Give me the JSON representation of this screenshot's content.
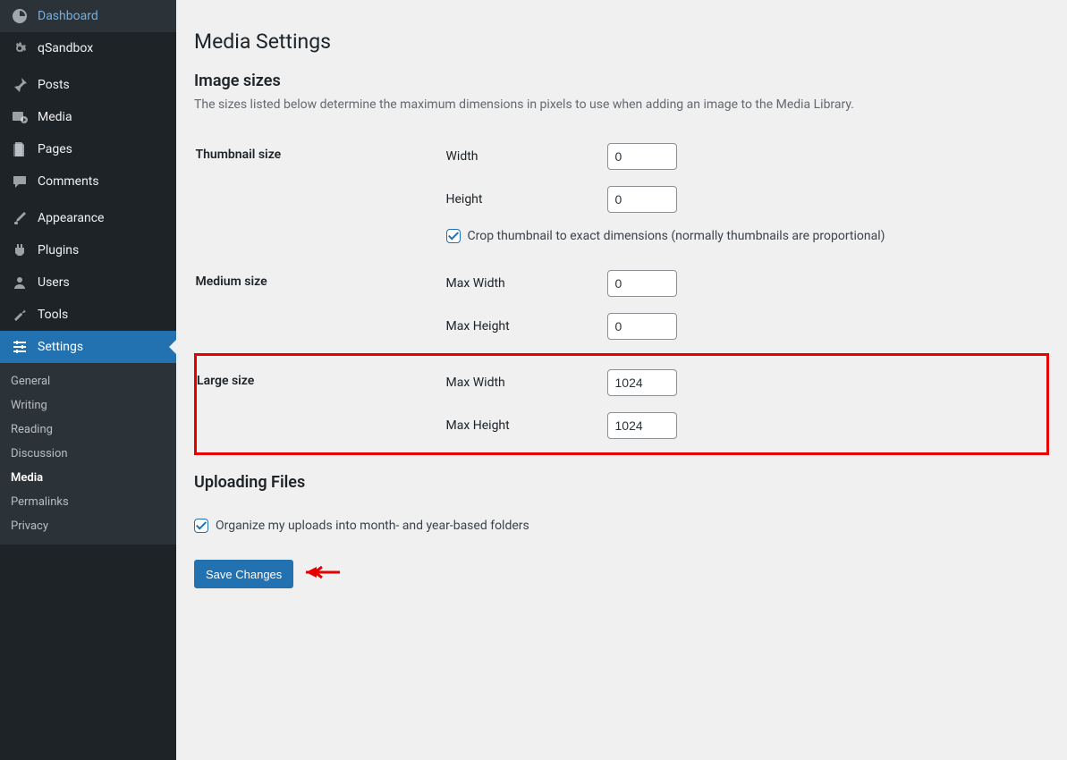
{
  "sidebar": {
    "items": [
      {
        "icon": "dashboard",
        "label": "Dashboard"
      },
      {
        "icon": "gear",
        "label": "qSandbox"
      },
      {
        "icon": "pin",
        "label": "Posts"
      },
      {
        "icon": "media",
        "label": "Media"
      },
      {
        "icon": "page",
        "label": "Pages"
      },
      {
        "icon": "comment",
        "label": "Comments"
      },
      {
        "icon": "brush",
        "label": "Appearance"
      },
      {
        "icon": "plugin",
        "label": "Plugins"
      },
      {
        "icon": "user",
        "label": "Users"
      },
      {
        "icon": "wrench",
        "label": "Tools"
      },
      {
        "icon": "settings",
        "label": "Settings"
      }
    ],
    "submenu": [
      {
        "label": "General"
      },
      {
        "label": "Writing"
      },
      {
        "label": "Reading"
      },
      {
        "label": "Discussion"
      },
      {
        "label": "Media"
      },
      {
        "label": "Permalinks"
      },
      {
        "label": "Privacy"
      }
    ]
  },
  "page": {
    "title": "Media Settings",
    "image_sizes_heading": "Image sizes",
    "image_sizes_description": "The sizes listed below determine the maximum dimensions in pixels to use when adding an image to the Media Library.",
    "thumbnail": {
      "label": "Thumbnail size",
      "width_label": "Width",
      "width_value": "0",
      "height_label": "Height",
      "height_value": "0",
      "crop_label": "Crop thumbnail to exact dimensions (normally thumbnails are proportional)"
    },
    "medium": {
      "label": "Medium size",
      "max_width_label": "Max Width",
      "max_width_value": "0",
      "max_height_label": "Max Height",
      "max_height_value": "0"
    },
    "large": {
      "label": "Large size",
      "max_width_label": "Max Width",
      "max_width_value": "1024",
      "max_height_label": "Max Height",
      "max_height_value": "1024"
    },
    "uploading_heading": "Uploading Files",
    "organize_label": "Organize my uploads into month- and year-based folders",
    "save_button": "Save Changes"
  }
}
